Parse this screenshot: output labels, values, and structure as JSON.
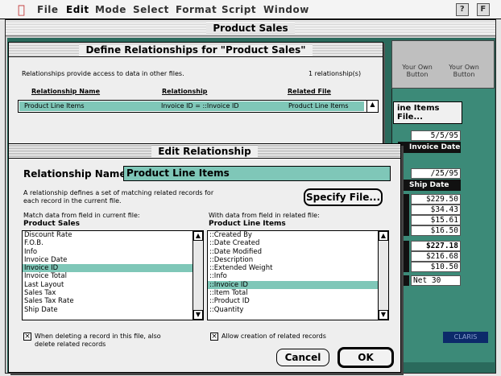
{
  "menubar": {
    "apple": "",
    "items": [
      "File",
      "Edit",
      "Mode",
      "Select",
      "Format",
      "Script",
      "Window"
    ],
    "help": "?",
    "finder": "F"
  },
  "bgwin": {
    "title": "Product Sales",
    "buttons": [
      "Your Own Button",
      "Your Own Button"
    ],
    "line_items_btn": "ine Items File...",
    "date1": "5/5/95",
    "invoice_date_label": "Invoice Date",
    "date2": "/25/95",
    "ship_date_label": "Ship Date",
    "amounts": [
      "$229.50",
      "$34.43",
      "$15.61",
      "$16.50",
      "$227.18",
      "$216.68",
      "$10.50"
    ],
    "terms": "Net 30",
    "stripe": "CLARIS"
  },
  "define": {
    "title": "Define Relationships for \"Product Sales\"",
    "desc": "Relationships provide access to data in other files.",
    "count": "1 relationship(s)",
    "col_name": "Relationship Name",
    "col_rel": "Relationship",
    "col_file": "Related File",
    "row": {
      "name": "Product Line Items",
      "rel": "Invoice ID = ::Invoice ID",
      "file": "Product Line Items"
    }
  },
  "edit": {
    "title": "Edit Relationship",
    "name_label": "Relationship Name",
    "name_value": "Product Line Items",
    "desc1": "A relationship defines a set of matching related records for",
    "desc2": "each record in the current file.",
    "specify": "Specify File...",
    "left_head1": "Match data from field in current file:",
    "left_head2": "Product Sales",
    "right_head1": "With data from field in related file:",
    "right_head2": "Product Line Items",
    "left_items": [
      "Discount Rate",
      "F.O.B.",
      "Info",
      "Invoice Date",
      "Invoice ID",
      "Invoice Total",
      "Last Layout",
      "Sales Tax",
      "Sales Tax Rate",
      "Ship Date"
    ],
    "left_selected": 4,
    "right_items": [
      "::Created By",
      "::Date Created",
      "::Date Modified",
      "::Description",
      "::Extended Weight",
      "::Info",
      "::Invoice ID",
      "::Item Total",
      "::Product ID",
      "::Quantity"
    ],
    "right_selected": 6,
    "chk1a": "When deleting a record in this file, also",
    "chk1b": "delete related records",
    "chk2": "Allow creation of related records",
    "cancel": "Cancel",
    "ok": "OK"
  }
}
